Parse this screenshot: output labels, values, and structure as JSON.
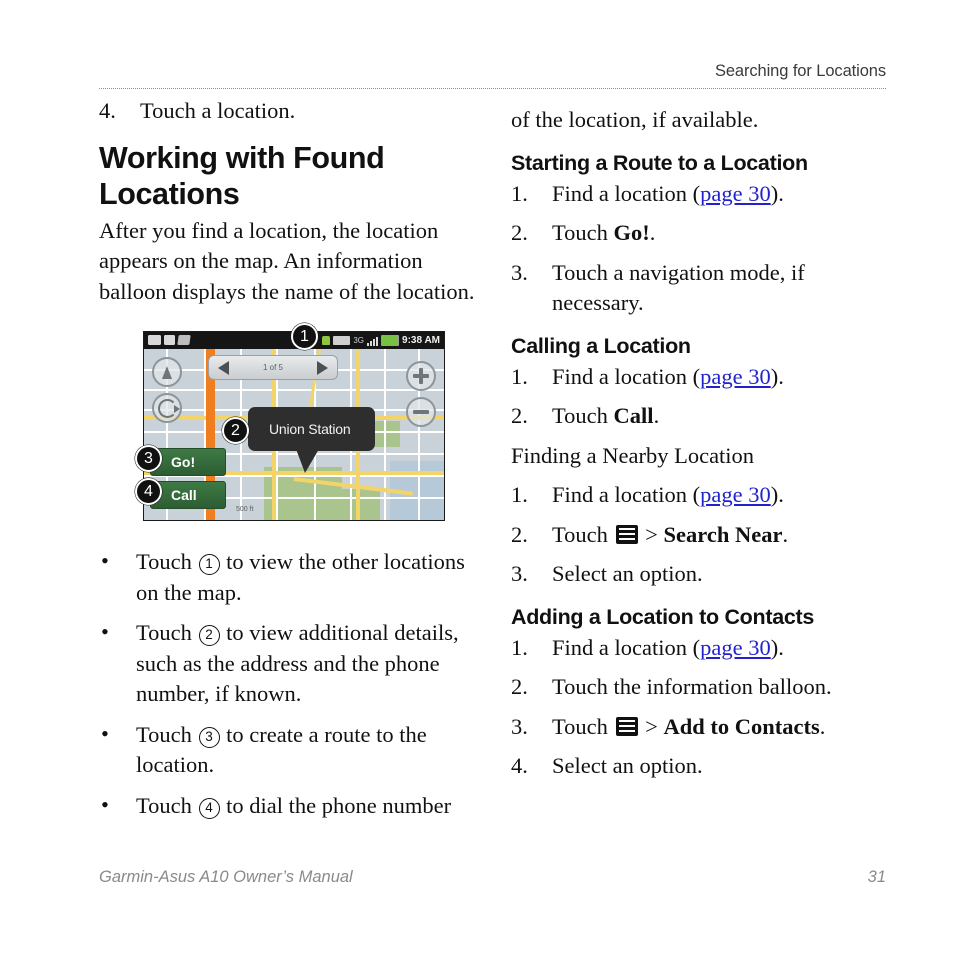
{
  "header": {
    "running_head": "Searching for Locations"
  },
  "left_column": {
    "step4": {
      "marker": "4.",
      "text": "Touch a location."
    },
    "section_title": "Working with Found Locations",
    "intro": "After you find a location, the location appears on the map. An information balloon displays the name of the location.",
    "figure": {
      "status_bar": {
        "time": "9:38 AM",
        "network": "3G"
      },
      "balloon_label": "Union Station",
      "go_button": "Go!",
      "call_button": "Call",
      "scale_label": "500 ft",
      "callouts": [
        "1",
        "2",
        "3",
        "4"
      ],
      "pager_label": "1 of 5"
    },
    "bullets": [
      {
        "bullet": "•",
        "pre": "Touch ",
        "circle": "1",
        "post": " to view the other locations on the map."
      },
      {
        "bullet": "•",
        "pre": "Touch ",
        "circle": "2",
        "post": " to view additional details, such as the address and the phone number, if known."
      },
      {
        "bullet": "•",
        "pre": "Touch ",
        "circle": "3",
        "post": " to create a route to the location."
      },
      {
        "bullet": "•",
        "pre": "Touch ",
        "circle": "4",
        "post": "  to dial the phone number"
      }
    ]
  },
  "right_column": {
    "continuation": "of the location, if available.",
    "sections": [
      {
        "heading": "Starting a Route to a Location",
        "steps": [
          {
            "marker": "1.",
            "pre": "Find a location (",
            "link": "page 30",
            "post": ")."
          },
          {
            "marker": "2.",
            "pre": "Touch ",
            "bold": "Go!",
            "post": "."
          },
          {
            "marker": "3.",
            "pre": "Touch a navigation mode, if necessary.",
            "post": ""
          }
        ]
      },
      {
        "heading": "Calling a Location",
        "steps": [
          {
            "marker": "1.",
            "pre": "Find a location (",
            "link": "page 30",
            "post": ")."
          },
          {
            "marker": "2.",
            "pre": "Touch ",
            "bold": "Call",
            "post": "."
          }
        ]
      }
    ],
    "nearby_paragraph": "Finding a Nearby Location",
    "nearby_steps": [
      {
        "marker": "1.",
        "pre": "Find a location (",
        "link": "page 30",
        "post": ")."
      },
      {
        "marker": "2.",
        "pre": "Touch ",
        "icon": "menu-icon",
        "mid": " > ",
        "bold": "Search Near",
        "post": "."
      },
      {
        "marker": "3.",
        "pre": "Select an option.",
        "post": ""
      }
    ],
    "contacts_section": {
      "heading": "Adding a Location to Contacts",
      "steps": [
        {
          "marker": "1.",
          "pre": "Find a location (",
          "link": "page 30",
          "post": ")."
        },
        {
          "marker": "2.",
          "pre": "Touch the information balloon.",
          "post": ""
        },
        {
          "marker": "3.",
          "pre": "Touch ",
          "icon": "menu-icon",
          "mid": " > ",
          "bold": "Add to Contacts",
          "post": "."
        },
        {
          "marker": "4.",
          "pre": "Select an option.",
          "post": ""
        }
      ]
    }
  },
  "footer": {
    "manual_title": "Garmin-Asus A10 Owner’s Manual",
    "page_number": "31"
  },
  "colors": {
    "link": "#2222cc",
    "header_text": "#3b3b3b",
    "footer_text": "#8a8a8a",
    "button_green": "#2d5d33",
    "balloon": "#2e2e2e"
  }
}
